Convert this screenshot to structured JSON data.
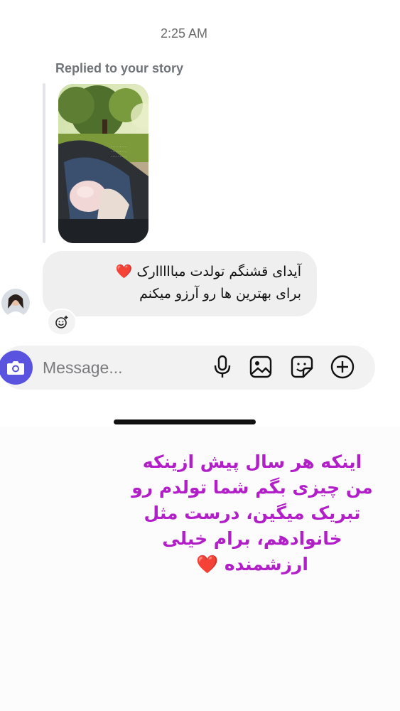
{
  "conversation": {
    "timestamp": "2:25 AM",
    "story_reply": {
      "label": "Replied to your story",
      "thumbnail": "story-photo: baby in stroller in park"
    },
    "message": {
      "line1": "آیدای قشنگم تولدت مبااااارک ❤️",
      "line2": "برای بهترین ها رو آرزو میکنم"
    },
    "react_icon": "add-reaction-icon"
  },
  "composer": {
    "placeholder": "Message...",
    "icons": [
      "camera-icon",
      "microphone-icon",
      "gallery-icon",
      "sticker-icon",
      "plus-circle-icon"
    ],
    "accent": "#5a53e0"
  },
  "overlay_caption": {
    "line1": "اینکه هر سال پیش ازینکه",
    "line2": "من چیزی بگم شما تولدم رو",
    "line3": "تبریک میگین، درست مثل",
    "line4": "خانوادهم، برام خیلی",
    "line5": "ارزشمنده",
    "heart": "❤️",
    "color": "#b21fc9"
  }
}
